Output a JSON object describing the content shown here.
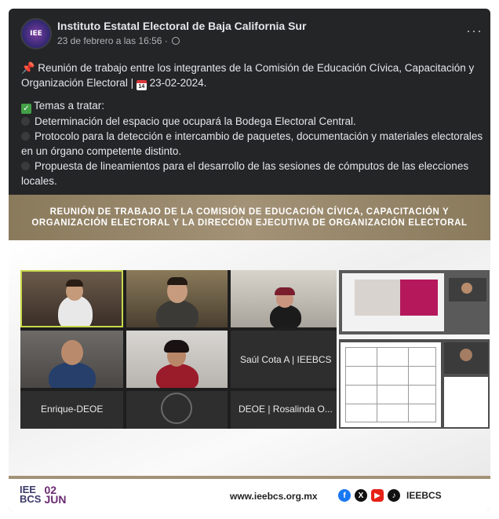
{
  "post": {
    "page_name": "Instituto Estatal Electoral de Baja California Sur",
    "timestamp": "23 de febrero a las 16:56 ·",
    "avatar_text": "IEE",
    "more": "···",
    "intro": "Reunión de trabajo entre los integrantes de la Comisión de Educación Cívica, Capacitación y Organización Electoral |",
    "intro_date": "23-02-2024.",
    "topics_heading": "Temas a tratar:",
    "topics": [
      "Determinación del espacio que ocupará la Bodega Electoral Central.",
      "Protocolo para la detección e intercambio de paquetes, documentación y materiales electorales en un órgano competente distinto.",
      "Propuesta de lineamientos para el desarrollo de las sesiones de cómputos de las elecciones locales."
    ]
  },
  "image": {
    "banner_line1": "REUNIÓN DE TRABAJO DE LA COMISIÓN DE EDUCACIÓN CÍVICA, CAPACITACIÓN Y",
    "banner_line2": "ORGANIZACIÓN ELECTORAL Y LA DIRECCIÓN EJECUTIVA DE ORGANIZACIÓN ELECTORAL",
    "participants": {
      "tile6": "Saúl Cota A | IEEBCS",
      "tile7": "Enrique-DEOE",
      "tile9": "DEOE | Rosalinda O..."
    },
    "footer": {
      "logo_text_top": "IEE",
      "logo_text_bottom": "BCS",
      "logo_date_top": "02",
      "logo_date_bottom": "JUN",
      "website": "www.ieebcs.org.mx",
      "handle": "IEEBCS"
    }
  },
  "colors": {
    "card": "#242526",
    "banner": "#a39276",
    "facebook": "#1877f2",
    "youtube": "#e62117"
  }
}
